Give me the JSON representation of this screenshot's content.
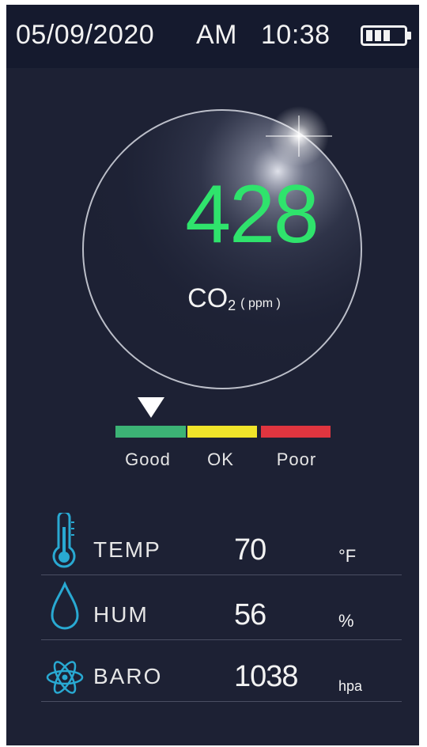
{
  "status_bar": {
    "date": "05/09/2020",
    "period": "AM",
    "time": "10:38",
    "battery_icon": "battery-icon",
    "battery_level": 0.75
  },
  "co2": {
    "value": "428",
    "label": "CO",
    "subscript": "2",
    "unit": "( ppm )",
    "value_color": "#2fe36c"
  },
  "air_quality_scale": {
    "indicator": "Good",
    "levels": [
      {
        "label": "Good",
        "color": "#3cb375"
      },
      {
        "label": "OK",
        "color": "#f0e42a"
      },
      {
        "label": "Poor",
        "color": "#e0353f"
      }
    ]
  },
  "readings": [
    {
      "icon": "thermometer-icon",
      "label": "TEMP",
      "value": "70",
      "unit": "°F"
    },
    {
      "icon": "water-drop-icon",
      "label": "HUM",
      "value": "56",
      "unit": "%"
    },
    {
      "icon": "atom-icon",
      "label": "BARO",
      "value": "1038",
      "unit": "hpa"
    }
  ],
  "colors": {
    "background": "#1d2134",
    "status_bar": "#151a2e",
    "icon_accent": "#29a9d2"
  }
}
